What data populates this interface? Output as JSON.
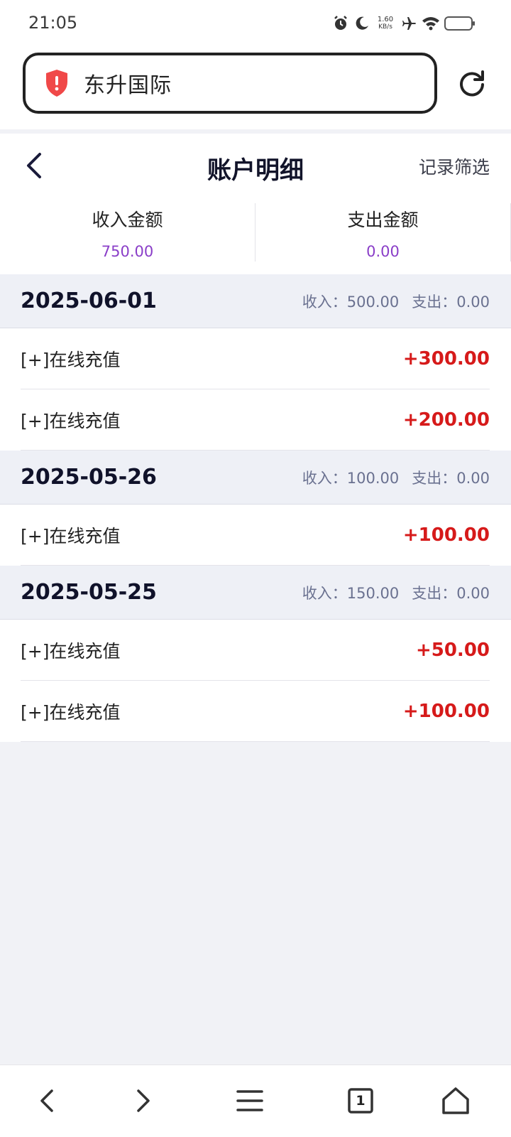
{
  "status_bar": {
    "time": "21:05",
    "net_speed_value": "1.60",
    "net_speed_unit": "KB/s",
    "icons": [
      "alarm-icon",
      "moon-icon",
      "airplane-icon",
      "wifi-icon",
      "battery-icon"
    ]
  },
  "browser": {
    "url_text": "东升国际",
    "tab_count": "1"
  },
  "header": {
    "title": "账户明细",
    "filter_label": "记录筛选"
  },
  "summary": {
    "income_label": "收入金额",
    "income_value": "750.00",
    "expense_label": "支出金额",
    "expense_value": "0.00"
  },
  "groups": [
    {
      "date": "2025-06-01",
      "income": "收入：500.00",
      "expense": "支出：0.00",
      "items": [
        {
          "label": "[+]在线充值",
          "amount": "+300.00"
        },
        {
          "label": "[+]在线充值",
          "amount": "+200.00"
        }
      ]
    },
    {
      "date": "2025-05-26",
      "income": "收入：100.00",
      "expense": "支出：0.00",
      "items": [
        {
          "label": "[+]在线充值",
          "amount": "+100.00"
        }
      ]
    },
    {
      "date": "2025-05-25",
      "income": "收入：150.00",
      "expense": "支出：0.00",
      "items": [
        {
          "label": "[+]在线充值",
          "amount": "+50.00"
        },
        {
          "label": "[+]在线充值",
          "amount": "+100.00"
        }
      ]
    }
  ],
  "colors": {
    "accent_purple": "#8a3ec8",
    "amount_red": "#d61a1a",
    "shield_red": "#f04848"
  }
}
